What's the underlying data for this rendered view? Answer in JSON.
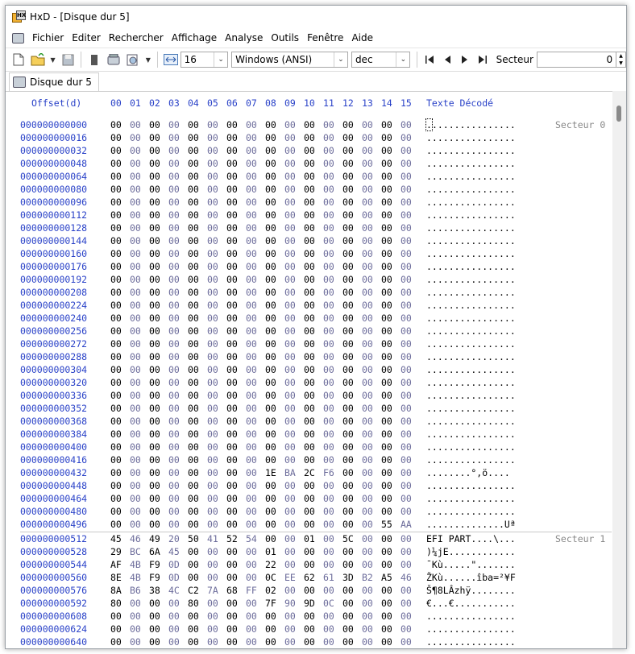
{
  "window": {
    "title": "HxD - [Disque dur 5]"
  },
  "menu": [
    "Fichier",
    "Editer",
    "Rechercher",
    "Affichage",
    "Analyse",
    "Outils",
    "Fenêtre",
    "Aide"
  ],
  "toolbar": {
    "bytes_per_row": "16",
    "charset": "Windows (ANSI)",
    "offset_base": "dec",
    "sector_label": "Secteur",
    "sector_value": "0"
  },
  "tabs": [
    {
      "label": "Disque dur 5"
    }
  ],
  "hex": {
    "offset_header": "Offset(d)",
    "columns": [
      "00",
      "01",
      "02",
      "03",
      "04",
      "05",
      "06",
      "07",
      "08",
      "09",
      "10",
      "11",
      "12",
      "13",
      "14",
      "15"
    ],
    "text_header": "Texte Décodé",
    "sector_labels": [
      "Secteur 0",
      "Secteur 1"
    ],
    "rows": [
      {
        "offset": "000000000000",
        "bytes": [
          "00",
          "00",
          "00",
          "00",
          "00",
          "00",
          "00",
          "00",
          "00",
          "00",
          "00",
          "00",
          "00",
          "00",
          "00",
          "00"
        ],
        "text": "................"
      },
      {
        "offset": "000000000016",
        "bytes": [
          "00",
          "00",
          "00",
          "00",
          "00",
          "00",
          "00",
          "00",
          "00",
          "00",
          "00",
          "00",
          "00",
          "00",
          "00",
          "00"
        ],
        "text": "................"
      },
      {
        "offset": "000000000032",
        "bytes": [
          "00",
          "00",
          "00",
          "00",
          "00",
          "00",
          "00",
          "00",
          "00",
          "00",
          "00",
          "00",
          "00",
          "00",
          "00",
          "00"
        ],
        "text": "................"
      },
      {
        "offset": "000000000048",
        "bytes": [
          "00",
          "00",
          "00",
          "00",
          "00",
          "00",
          "00",
          "00",
          "00",
          "00",
          "00",
          "00",
          "00",
          "00",
          "00",
          "00"
        ],
        "text": "................"
      },
      {
        "offset": "000000000064",
        "bytes": [
          "00",
          "00",
          "00",
          "00",
          "00",
          "00",
          "00",
          "00",
          "00",
          "00",
          "00",
          "00",
          "00",
          "00",
          "00",
          "00"
        ],
        "text": "................"
      },
      {
        "offset": "000000000080",
        "bytes": [
          "00",
          "00",
          "00",
          "00",
          "00",
          "00",
          "00",
          "00",
          "00",
          "00",
          "00",
          "00",
          "00",
          "00",
          "00",
          "00"
        ],
        "text": "................"
      },
      {
        "offset": "000000000096",
        "bytes": [
          "00",
          "00",
          "00",
          "00",
          "00",
          "00",
          "00",
          "00",
          "00",
          "00",
          "00",
          "00",
          "00",
          "00",
          "00",
          "00"
        ],
        "text": "................"
      },
      {
        "offset": "000000000112",
        "bytes": [
          "00",
          "00",
          "00",
          "00",
          "00",
          "00",
          "00",
          "00",
          "00",
          "00",
          "00",
          "00",
          "00",
          "00",
          "00",
          "00"
        ],
        "text": "................"
      },
      {
        "offset": "000000000128",
        "bytes": [
          "00",
          "00",
          "00",
          "00",
          "00",
          "00",
          "00",
          "00",
          "00",
          "00",
          "00",
          "00",
          "00",
          "00",
          "00",
          "00"
        ],
        "text": "................"
      },
      {
        "offset": "000000000144",
        "bytes": [
          "00",
          "00",
          "00",
          "00",
          "00",
          "00",
          "00",
          "00",
          "00",
          "00",
          "00",
          "00",
          "00",
          "00",
          "00",
          "00"
        ],
        "text": "................"
      },
      {
        "offset": "000000000160",
        "bytes": [
          "00",
          "00",
          "00",
          "00",
          "00",
          "00",
          "00",
          "00",
          "00",
          "00",
          "00",
          "00",
          "00",
          "00",
          "00",
          "00"
        ],
        "text": "................"
      },
      {
        "offset": "000000000176",
        "bytes": [
          "00",
          "00",
          "00",
          "00",
          "00",
          "00",
          "00",
          "00",
          "00",
          "00",
          "00",
          "00",
          "00",
          "00",
          "00",
          "00"
        ],
        "text": "................"
      },
      {
        "offset": "000000000192",
        "bytes": [
          "00",
          "00",
          "00",
          "00",
          "00",
          "00",
          "00",
          "00",
          "00",
          "00",
          "00",
          "00",
          "00",
          "00",
          "00",
          "00"
        ],
        "text": "................"
      },
      {
        "offset": "000000000208",
        "bytes": [
          "00",
          "00",
          "00",
          "00",
          "00",
          "00",
          "00",
          "00",
          "00",
          "00",
          "00",
          "00",
          "00",
          "00",
          "00",
          "00"
        ],
        "text": "................"
      },
      {
        "offset": "000000000224",
        "bytes": [
          "00",
          "00",
          "00",
          "00",
          "00",
          "00",
          "00",
          "00",
          "00",
          "00",
          "00",
          "00",
          "00",
          "00",
          "00",
          "00"
        ],
        "text": "................"
      },
      {
        "offset": "000000000240",
        "bytes": [
          "00",
          "00",
          "00",
          "00",
          "00",
          "00",
          "00",
          "00",
          "00",
          "00",
          "00",
          "00",
          "00",
          "00",
          "00",
          "00"
        ],
        "text": "................"
      },
      {
        "offset": "000000000256",
        "bytes": [
          "00",
          "00",
          "00",
          "00",
          "00",
          "00",
          "00",
          "00",
          "00",
          "00",
          "00",
          "00",
          "00",
          "00",
          "00",
          "00"
        ],
        "text": "................"
      },
      {
        "offset": "000000000272",
        "bytes": [
          "00",
          "00",
          "00",
          "00",
          "00",
          "00",
          "00",
          "00",
          "00",
          "00",
          "00",
          "00",
          "00",
          "00",
          "00",
          "00"
        ],
        "text": "................"
      },
      {
        "offset": "000000000288",
        "bytes": [
          "00",
          "00",
          "00",
          "00",
          "00",
          "00",
          "00",
          "00",
          "00",
          "00",
          "00",
          "00",
          "00",
          "00",
          "00",
          "00"
        ],
        "text": "................"
      },
      {
        "offset": "000000000304",
        "bytes": [
          "00",
          "00",
          "00",
          "00",
          "00",
          "00",
          "00",
          "00",
          "00",
          "00",
          "00",
          "00",
          "00",
          "00",
          "00",
          "00"
        ],
        "text": "................"
      },
      {
        "offset": "000000000320",
        "bytes": [
          "00",
          "00",
          "00",
          "00",
          "00",
          "00",
          "00",
          "00",
          "00",
          "00",
          "00",
          "00",
          "00",
          "00",
          "00",
          "00"
        ],
        "text": "................"
      },
      {
        "offset": "000000000336",
        "bytes": [
          "00",
          "00",
          "00",
          "00",
          "00",
          "00",
          "00",
          "00",
          "00",
          "00",
          "00",
          "00",
          "00",
          "00",
          "00",
          "00"
        ],
        "text": "................"
      },
      {
        "offset": "000000000352",
        "bytes": [
          "00",
          "00",
          "00",
          "00",
          "00",
          "00",
          "00",
          "00",
          "00",
          "00",
          "00",
          "00",
          "00",
          "00",
          "00",
          "00"
        ],
        "text": "................"
      },
      {
        "offset": "000000000368",
        "bytes": [
          "00",
          "00",
          "00",
          "00",
          "00",
          "00",
          "00",
          "00",
          "00",
          "00",
          "00",
          "00",
          "00",
          "00",
          "00",
          "00"
        ],
        "text": "................"
      },
      {
        "offset": "000000000384",
        "bytes": [
          "00",
          "00",
          "00",
          "00",
          "00",
          "00",
          "00",
          "00",
          "00",
          "00",
          "00",
          "00",
          "00",
          "00",
          "00",
          "00"
        ],
        "text": "................"
      },
      {
        "offset": "000000000400",
        "bytes": [
          "00",
          "00",
          "00",
          "00",
          "00",
          "00",
          "00",
          "00",
          "00",
          "00",
          "00",
          "00",
          "00",
          "00",
          "00",
          "00"
        ],
        "text": "................"
      },
      {
        "offset": "000000000416",
        "bytes": [
          "00",
          "00",
          "00",
          "00",
          "00",
          "00",
          "00",
          "00",
          "00",
          "00",
          "00",
          "00",
          "00",
          "00",
          "00",
          "00"
        ],
        "text": "................"
      },
      {
        "offset": "000000000432",
        "bytes": [
          "00",
          "00",
          "00",
          "00",
          "00",
          "00",
          "00",
          "00",
          "1E",
          "BA",
          "2C",
          "F6",
          "00",
          "00",
          "00",
          "00"
        ],
        "text": "........°,ö...."
      },
      {
        "offset": "000000000448",
        "bytes": [
          "00",
          "00",
          "00",
          "00",
          "00",
          "00",
          "00",
          "00",
          "00",
          "00",
          "00",
          "00",
          "00",
          "00",
          "00",
          "00"
        ],
        "text": "................"
      },
      {
        "offset": "000000000464",
        "bytes": [
          "00",
          "00",
          "00",
          "00",
          "00",
          "00",
          "00",
          "00",
          "00",
          "00",
          "00",
          "00",
          "00",
          "00",
          "00",
          "00"
        ],
        "text": "................"
      },
      {
        "offset": "000000000480",
        "bytes": [
          "00",
          "00",
          "00",
          "00",
          "00",
          "00",
          "00",
          "00",
          "00",
          "00",
          "00",
          "00",
          "00",
          "00",
          "00",
          "00"
        ],
        "text": "................"
      },
      {
        "offset": "000000000496",
        "bytes": [
          "00",
          "00",
          "00",
          "00",
          "00",
          "00",
          "00",
          "00",
          "00",
          "00",
          "00",
          "00",
          "00",
          "00",
          "55",
          "AA"
        ],
        "text": "..............Uª"
      },
      {
        "offset": "000000000512",
        "bytes": [
          "45",
          "46",
          "49",
          "20",
          "50",
          "41",
          "52",
          "54",
          "00",
          "00",
          "01",
          "00",
          "5C",
          "00",
          "00",
          "00"
        ],
        "text": "EFI PART....\\..."
      },
      {
        "offset": "000000000528",
        "bytes": [
          "29",
          "BC",
          "6A",
          "45",
          "00",
          "00",
          "00",
          "00",
          "01",
          "00",
          "00",
          "00",
          "00",
          "00",
          "00",
          "00"
        ],
        "text": ")¼jE............"
      },
      {
        "offset": "000000000544",
        "bytes": [
          "AF",
          "4B",
          "F9",
          "0D",
          "00",
          "00",
          "00",
          "00",
          "22",
          "00",
          "00",
          "00",
          "00",
          "00",
          "00",
          "00"
        ],
        "text": "¯Kù.....\"......."
      },
      {
        "offset": "000000000560",
        "bytes": [
          "8E",
          "4B",
          "F9",
          "0D",
          "00",
          "00",
          "00",
          "00",
          "0C",
          "EE",
          "62",
          "61",
          "3D",
          "B2",
          "A5",
          "46"
        ],
        "text": "ŽKù......îba=²¥F"
      },
      {
        "offset": "000000000576",
        "bytes": [
          "8A",
          "B6",
          "38",
          "4C",
          "C2",
          "7A",
          "68",
          "FF",
          "02",
          "00",
          "00",
          "00",
          "00",
          "00",
          "00",
          "00"
        ],
        "text": "Š¶8LÂzhÿ........"
      },
      {
        "offset": "000000000592",
        "bytes": [
          "80",
          "00",
          "00",
          "00",
          "80",
          "00",
          "00",
          "00",
          "7F",
          "90",
          "9D",
          "0C",
          "00",
          "00",
          "00",
          "00"
        ],
        "text": "€...€..........."
      },
      {
        "offset": "000000000608",
        "bytes": [
          "00",
          "00",
          "00",
          "00",
          "00",
          "00",
          "00",
          "00",
          "00",
          "00",
          "00",
          "00",
          "00",
          "00",
          "00",
          "00"
        ],
        "text": "................"
      },
      {
        "offset": "000000000624",
        "bytes": [
          "00",
          "00",
          "00",
          "00",
          "00",
          "00",
          "00",
          "00",
          "00",
          "00",
          "00",
          "00",
          "00",
          "00",
          "00",
          "00"
        ],
        "text": "................"
      },
      {
        "offset": "000000000640",
        "bytes": [
          "00",
          "00",
          "00",
          "00",
          "00",
          "00",
          "00",
          "00",
          "00",
          "00",
          "00",
          "00",
          "00",
          "00",
          "00",
          "00"
        ],
        "text": "................"
      }
    ]
  },
  "colors": {
    "offset_blue": "#2a42c8",
    "odd_byte": "#6b6b9a",
    "sector_gray": "#888888"
  }
}
